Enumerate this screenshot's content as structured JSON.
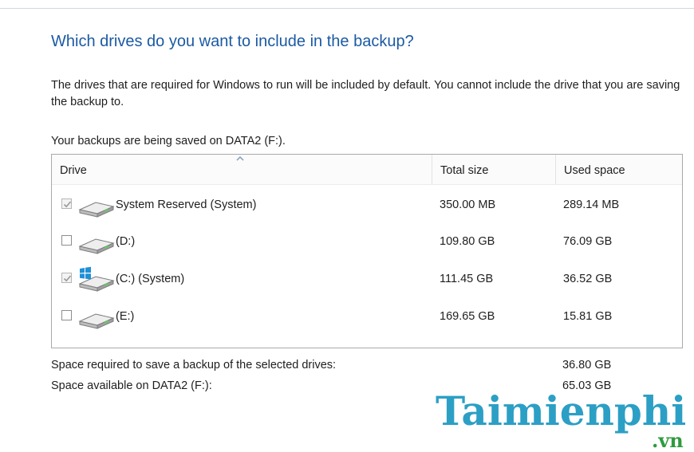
{
  "heading": "Which drives do you want to include in the backup?",
  "description": "The drives that are required for Windows to run will be included by default. You cannot include the drive that you are saving the backup to.",
  "saved_on": "Your backups are being saved on DATA2 (F:).",
  "table": {
    "columns": {
      "drive": "Drive",
      "total_size": "Total size",
      "used_space": "Used space"
    },
    "sort_indicator_icon": "sort-ascending-icon",
    "rows": [
      {
        "name": "System Reserved (System)",
        "total_size": "350.00 MB",
        "used_space": "289.14 MB",
        "checked": true,
        "disabled": true,
        "icon": "hard-drive-icon"
      },
      {
        "name": "(D:)",
        "total_size": "109.80 GB",
        "used_space": "76.09 GB",
        "checked": false,
        "disabled": false,
        "icon": "hard-drive-icon"
      },
      {
        "name": "(C:) (System)",
        "total_size": "111.45 GB",
        "used_space": "36.52 GB",
        "checked": true,
        "disabled": true,
        "icon": "windows-drive-icon"
      },
      {
        "name": "(E:)",
        "total_size": "169.65 GB",
        "used_space": "15.81 GB",
        "checked": false,
        "disabled": false,
        "icon": "hard-drive-icon"
      }
    ]
  },
  "summary": {
    "required_label": "Space required to save a backup of the selected drives:",
    "required_value": "36.80 GB",
    "available_label": "Space available on DATA2 (F:):",
    "available_value": "65.03 GB"
  },
  "watermark": {
    "main": "Taimienphi",
    "sub": ".vn"
  },
  "colors": {
    "heading": "#1b5aa3",
    "watermark_main": "#2c9fc5",
    "watermark_sub": "#2f9b3f",
    "table_border": "#a9a9a9"
  }
}
